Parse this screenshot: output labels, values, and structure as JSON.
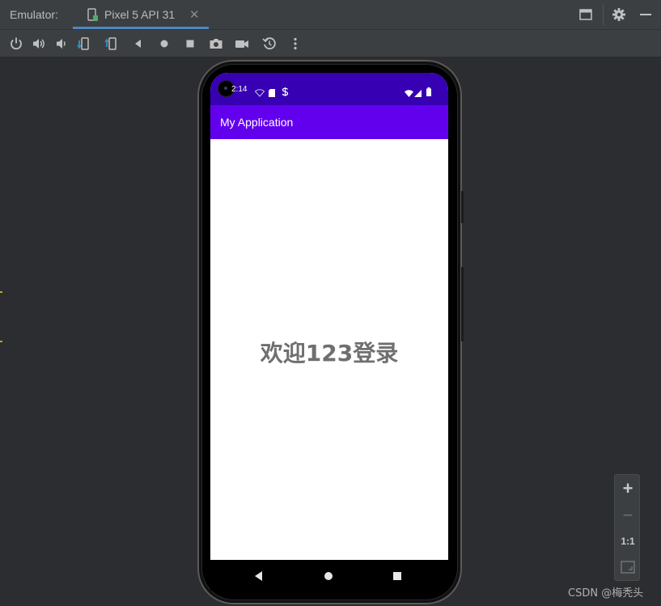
{
  "window": {
    "title": "Emulator:",
    "device_tab_label": "Pixel 5 API 31",
    "tab_close_glyph": "✕"
  },
  "toolbar": {
    "buttons": [
      "power-icon",
      "volume-up-icon",
      "volume-down-icon",
      "rotate-left-icon",
      "rotate-right-icon",
      "back-icon",
      "home-icon",
      "overview-icon",
      "screenshot-icon",
      "screen-record-icon",
      "snapshot-icon",
      "more-icon"
    ]
  },
  "device": {
    "status_time": "2:14",
    "app_title": "My Application",
    "welcome_text": "欢迎123登录",
    "status_bar_color": "#3700b3",
    "app_bar_color": "#6200ee"
  },
  "zoom": {
    "zoom_in": "+",
    "zoom_out": "−",
    "actual_size": "1:1"
  },
  "watermark": "CSDN @梅秃头",
  "colors": {
    "accent": "#4a88c7",
    "ide_background": "#2b2d30",
    "panel": "#3c3f41"
  }
}
